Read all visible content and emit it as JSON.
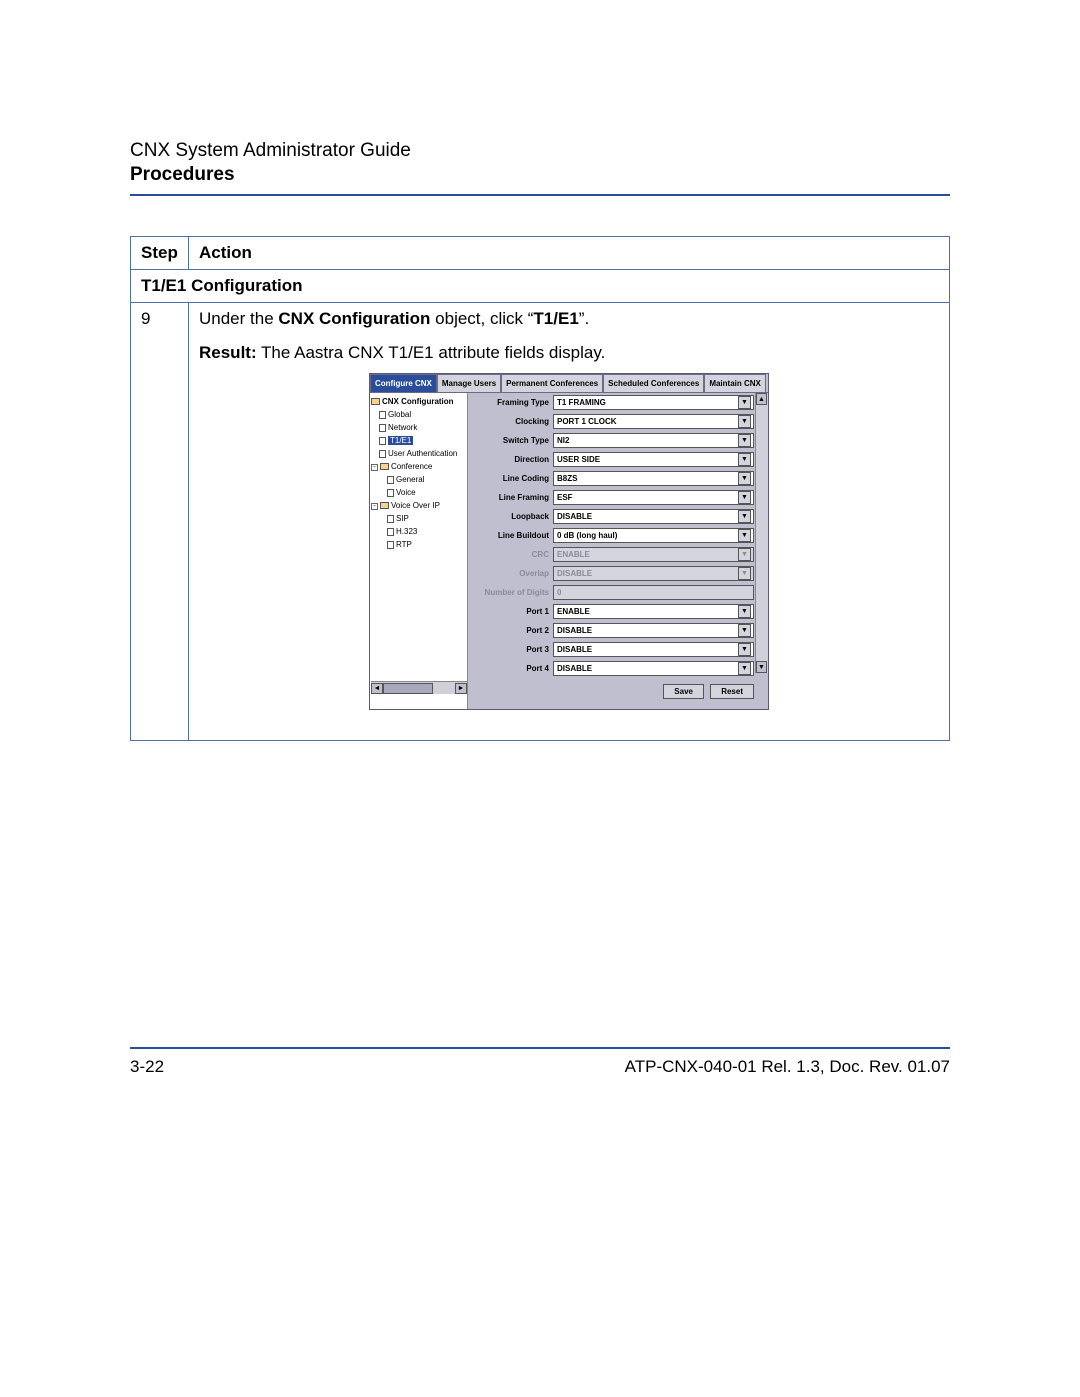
{
  "header": {
    "doc_title": "CNX System Administrator Guide",
    "section": "Procedures"
  },
  "table": {
    "head": {
      "step": "Step",
      "action": "Action"
    },
    "subheader": "T1/E1 Configuration",
    "row": {
      "step": "9",
      "action_prefix": "Under the ",
      "action_bold1": "CNX Configuration",
      "action_mid": " object, click “",
      "action_bold2": "T1/E1",
      "action_suffix": "”.",
      "result_label": "Result:",
      "result_text": " The Aastra CNX T1/E1 attribute fields display."
    }
  },
  "app": {
    "tabs": {
      "configure": "Configure CNX",
      "users": "Manage Users",
      "permanent": "Permanent Conferences",
      "scheduled": "Scheduled Conferences",
      "maintain": "Maintain CNX"
    },
    "tree": {
      "root": "CNX Configuration",
      "global": "Global",
      "network": "Network",
      "t1e1": "T1/E1",
      "userauth": "User Authentication",
      "conference": "Conference",
      "general": "General",
      "voice": "Voice",
      "voip": "Voice Over IP",
      "sip": "SIP",
      "h323": "H.323",
      "rtp": "RTP"
    },
    "fields": {
      "framing_type": {
        "label": "Framing Type",
        "value": "T1 FRAMING"
      },
      "clocking": {
        "label": "Clocking",
        "value": "PORT 1 CLOCK"
      },
      "switch_type": {
        "label": "Switch Type",
        "value": "NI2"
      },
      "direction": {
        "label": "Direction",
        "value": "USER SIDE"
      },
      "line_coding": {
        "label": "Line Coding",
        "value": "B8ZS"
      },
      "line_framing": {
        "label": "Line Framing",
        "value": "ESF"
      },
      "loopback": {
        "label": "Loopback",
        "value": "DISABLE"
      },
      "line_buildout": {
        "label": "Line Buildout",
        "value": "0 dB (long haul)"
      },
      "crc": {
        "label": "CRC",
        "value": "ENABLE"
      },
      "overlap": {
        "label": "Overlap",
        "value": "DISABLE"
      },
      "num_digits": {
        "label": "Number of Digits",
        "value": "0"
      },
      "port1": {
        "label": "Port 1",
        "value": "ENABLE"
      },
      "port2": {
        "label": "Port 2",
        "value": "DISABLE"
      },
      "port3": {
        "label": "Port 3",
        "value": "DISABLE"
      },
      "port4": {
        "label": "Port 4",
        "value": "DISABLE"
      }
    },
    "buttons": {
      "save": "Save",
      "reset": "Reset"
    }
  },
  "footer": {
    "page": "3-22",
    "doc_ref": "ATP-CNX-040-01 Rel. 1.3, Doc. Rev. 01.07"
  }
}
